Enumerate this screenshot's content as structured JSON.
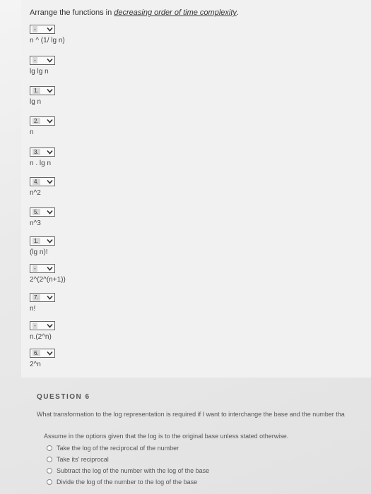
{
  "question5": {
    "instruction_prefix": "Arrange the functions in ",
    "instruction_emph": "decreasing order of time complexity",
    "instruction_suffix": ".",
    "items": [
      {
        "rank": "-",
        "fn": "n ^ (1/ lg n)"
      },
      {
        "rank": "-",
        "fn": "lg lg n"
      },
      {
        "rank": "1.",
        "fn": "lg n"
      },
      {
        "rank": "2.",
        "fn": "n"
      },
      {
        "rank": "3.",
        "fn": "n . lg n"
      },
      {
        "rank": "4.",
        "fn": "n^2"
      },
      {
        "rank": "5.",
        "fn": "n^3"
      },
      {
        "rank": "1.",
        "fn": "(lg n)!"
      },
      {
        "rank": "-",
        "fn": "2^(2^(n+1))"
      },
      {
        "rank": "7.",
        "fn": "n!"
      },
      {
        "rank": "-",
        "fn": "n.(2^n)"
      },
      {
        "rank": "6.",
        "fn": "2^n"
      }
    ]
  },
  "question6": {
    "title": "QUESTION 6",
    "prompt": "What transformation to the log representation is required if I want to interchange the base and the number tha",
    "assume": "Assume in the options given that the log is to the original base unless stated otherwise.",
    "options": [
      "Take the log of the reciprocal of the number",
      "Take its' reciprocal",
      "Subtract the log of the number with the log of the base",
      "Divide the log of the number to the log of the base"
    ]
  },
  "icons": {
    "select_arrow": "chevron-down-icon",
    "radio": "radio-button-icon"
  }
}
